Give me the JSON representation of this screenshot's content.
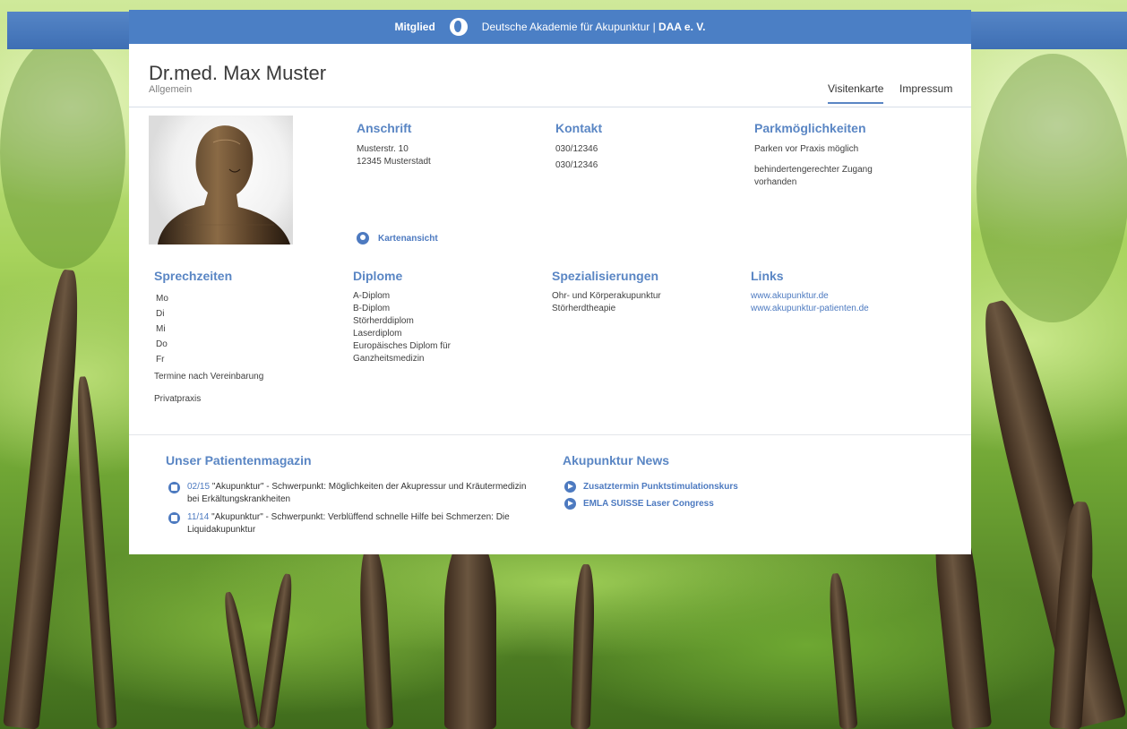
{
  "topbar": {
    "member_label": "Mitglied",
    "org_name": "Deutsche Akademie für Akupunktur |",
    "org_abbrev": "DAA e. V."
  },
  "doctor": {
    "name": "Dr.med. Max Muster",
    "category": "Allgemein"
  },
  "tabs": [
    {
      "label": "Visitenkarte",
      "active": true
    },
    {
      "label": "Impressum",
      "active": false
    }
  ],
  "address": {
    "heading": "Anschrift",
    "street": "Musterstr. 10",
    "city": "12345 Musterstadt",
    "map_link": "Kartenansicht"
  },
  "contact": {
    "heading": "Kontakt",
    "phone1": "030/12346",
    "phone2": "030/12346"
  },
  "parking": {
    "heading": "Parkmöglichkeiten",
    "line1": "Parken vor Praxis möglich",
    "line2": "behindertengerechter Zugang vorhanden"
  },
  "hours": {
    "heading": "Sprechzeiten",
    "days": [
      "Mo",
      "Di",
      "Mi",
      "Do",
      "Fr"
    ],
    "note": "Termine nach Vereinbarung",
    "practice_type": "Privatpraxis"
  },
  "diplomas": {
    "heading": "Diplome",
    "items": [
      "A-Diplom",
      "B-Diplom",
      "Störherddiplom",
      "Laserdiplom",
      "Europäisches Diplom für Ganzheitsmedizin"
    ]
  },
  "specializations": {
    "heading": "Spezialisierungen",
    "items": [
      "Ohr- und Körperakupunktur",
      "Störherdtheapie"
    ]
  },
  "links": {
    "heading": "Links",
    "items": [
      "www.akupunktur.de",
      "www.akupunktur-patienten.de"
    ]
  },
  "magazine": {
    "heading": "Unser Patientenmagazin",
    "items": [
      {
        "issue": "02/15",
        "text": "\"Akupunktur\" - Schwerpunkt: Möglichkeiten der Akupressur und Kräutermedizin bei Erkältungskrankheiten"
      },
      {
        "issue": "11/14",
        "text": "\"Akupunktur\" - Schwerpunkt: Verblüffend schnelle Hilfe bei Schmerzen: Die Liquidakupunktur"
      }
    ]
  },
  "news": {
    "heading": "Akupunktur News",
    "items": [
      "Zusatztermin Punktstimulationskurs",
      "EMLA SUISSE Laser Congress"
    ]
  },
  "colors": {
    "accent": "#4d7ac0",
    "topbar": "#4b7fc5"
  }
}
